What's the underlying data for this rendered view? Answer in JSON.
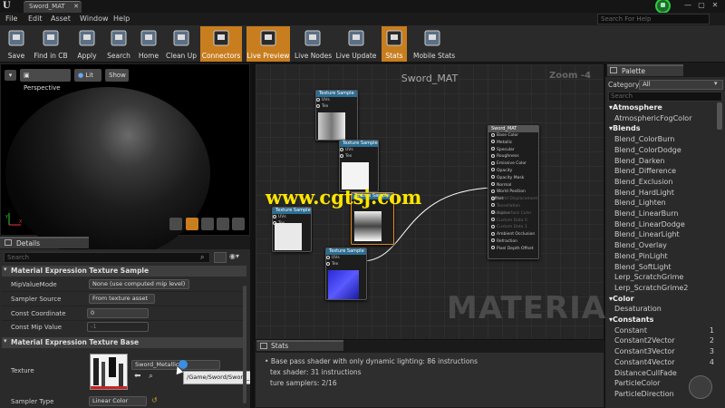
{
  "titlebar": {
    "tab_title": "Sword_MAT",
    "tab_close": "✕",
    "minimize": "—",
    "maximize": "▢",
    "close": "✕"
  },
  "menu": {
    "items": [
      "File",
      "Edit",
      "Asset",
      "Window",
      "Help"
    ],
    "help_search_placeholder": "Search For Help"
  },
  "toolbar": {
    "buttons": [
      {
        "label": "Save",
        "icon": "save-icon",
        "active": false
      },
      {
        "label": "Find in CB",
        "icon": "magnifier-icon",
        "active": false
      },
      {
        "label": "Apply",
        "icon": "checkmark-icon",
        "active": false
      },
      {
        "label": "Search",
        "icon": "binoculars-icon",
        "active": false
      },
      {
        "label": "Home",
        "icon": "home-icon",
        "active": false
      },
      {
        "label": "Clean Up",
        "icon": "broom-icon",
        "active": false
      },
      {
        "label": "Connectors",
        "icon": "connectors-icon",
        "active": true
      },
      {
        "label": "Live Preview",
        "icon": "monitor-check-icon",
        "active": true
      },
      {
        "label": "Live Nodes",
        "icon": "live-nodes-icon",
        "active": false
      },
      {
        "label": "Live Update",
        "icon": "live-update-icon",
        "active": false
      },
      {
        "label": "Stats",
        "icon": "stats-icon",
        "active": true
      },
      {
        "label": "Mobile Stats",
        "icon": "mobile-stats-icon",
        "active": false
      }
    ]
  },
  "viewport": {
    "dropdown": "▾",
    "perspective": "Perspective",
    "lit": "Lit",
    "show": "Show"
  },
  "details": {
    "tab": "Details",
    "search_placeholder": "Search",
    "section1": "Material Expression Texture Sample",
    "props1": [
      {
        "label": "MipValueMode",
        "value": "None (use computed mip level)"
      },
      {
        "label": "Sampler Source",
        "value": "From texture asset"
      },
      {
        "label": "Const Coordinate",
        "value": "0"
      },
      {
        "label": "Const Mip Value",
        "value": "-1"
      }
    ],
    "section2": "Material Expression Texture Base",
    "texture_label": "Texture",
    "texture_value": "Sword_Metallic",
    "tooltip": "/Game/Sword/Sword_Metallic",
    "sampler_type_label": "Sampler Type",
    "sampler_type_value": "Linear Color"
  },
  "graph": {
    "title": "Sword_MAT",
    "zoom": "Zoom -4",
    "watermark": "MATERIAL",
    "overlay_text": "www.cgtsj.com",
    "node_title": "Texture Sample",
    "node_pins": [
      "UVs",
      "Tex"
    ],
    "result_title": "Sword_MAT",
    "result_pins": [
      "Base Color",
      "Metallic",
      "Specular",
      "Roughness",
      "Emissive Color",
      "Opacity",
      "Opacity Mask",
      "Normal",
      "World Position Offset",
      "World Displacement",
      "Tessellation Multiplier",
      "Subsurface Color",
      "Custom Data 0",
      "Custom Data 1",
      "Ambient Occlusion",
      "Refraction",
      "Pixel Depth Offset"
    ]
  },
  "stats": {
    "tab": "Stats",
    "lines": [
      "Base pass shader with only dynamic lighting: 86 instructions",
      "tex shader: 31 instructions",
      "ture samplers: 2/16"
    ]
  },
  "palette": {
    "tab": "Palette",
    "category_label": "Category:",
    "category_value": "All",
    "search_placeholder": "Search",
    "items": [
      {
        "text": "Atmosphere",
        "cat": true
      },
      {
        "text": "AtmosphericFogColor"
      },
      {
        "text": "Blends",
        "cat": true
      },
      {
        "text": "Blend_ColorBurn"
      },
      {
        "text": "Blend_ColorDodge"
      },
      {
        "text": "Blend_Darken"
      },
      {
        "text": "Blend_Difference"
      },
      {
        "text": "Blend_Exclusion"
      },
      {
        "text": "Blend_HardLight"
      },
      {
        "text": "Blend_Lighten"
      },
      {
        "text": "Blend_LinearBurn"
      },
      {
        "text": "Blend_LinearDodge"
      },
      {
        "text": "Blend_LinearLight"
      },
      {
        "text": "Blend_Overlay"
      },
      {
        "text": "Blend_PinLight"
      },
      {
        "text": "Blend_SoftLight"
      },
      {
        "text": "Lerp_ScratchGrime"
      },
      {
        "text": "Lerp_ScratchGrime2"
      },
      {
        "text": "Color",
        "cat": true
      },
      {
        "text": "Desaturation"
      },
      {
        "text": "Constants",
        "cat": true
      },
      {
        "text": "Constant",
        "num": "1"
      },
      {
        "text": "Constant2Vector",
        "num": "2"
      },
      {
        "text": "Constant3Vector",
        "num": "3"
      },
      {
        "text": "Constant4Vector",
        "num": "4"
      },
      {
        "text": "DistanceCullFade"
      },
      {
        "text": "ParticleColor"
      },
      {
        "text": "ParticleDirection"
      }
    ]
  },
  "colors": {
    "accent": "#c87d1e",
    "node_header": "#2d6d92",
    "watermark_text": "#ffe600"
  }
}
